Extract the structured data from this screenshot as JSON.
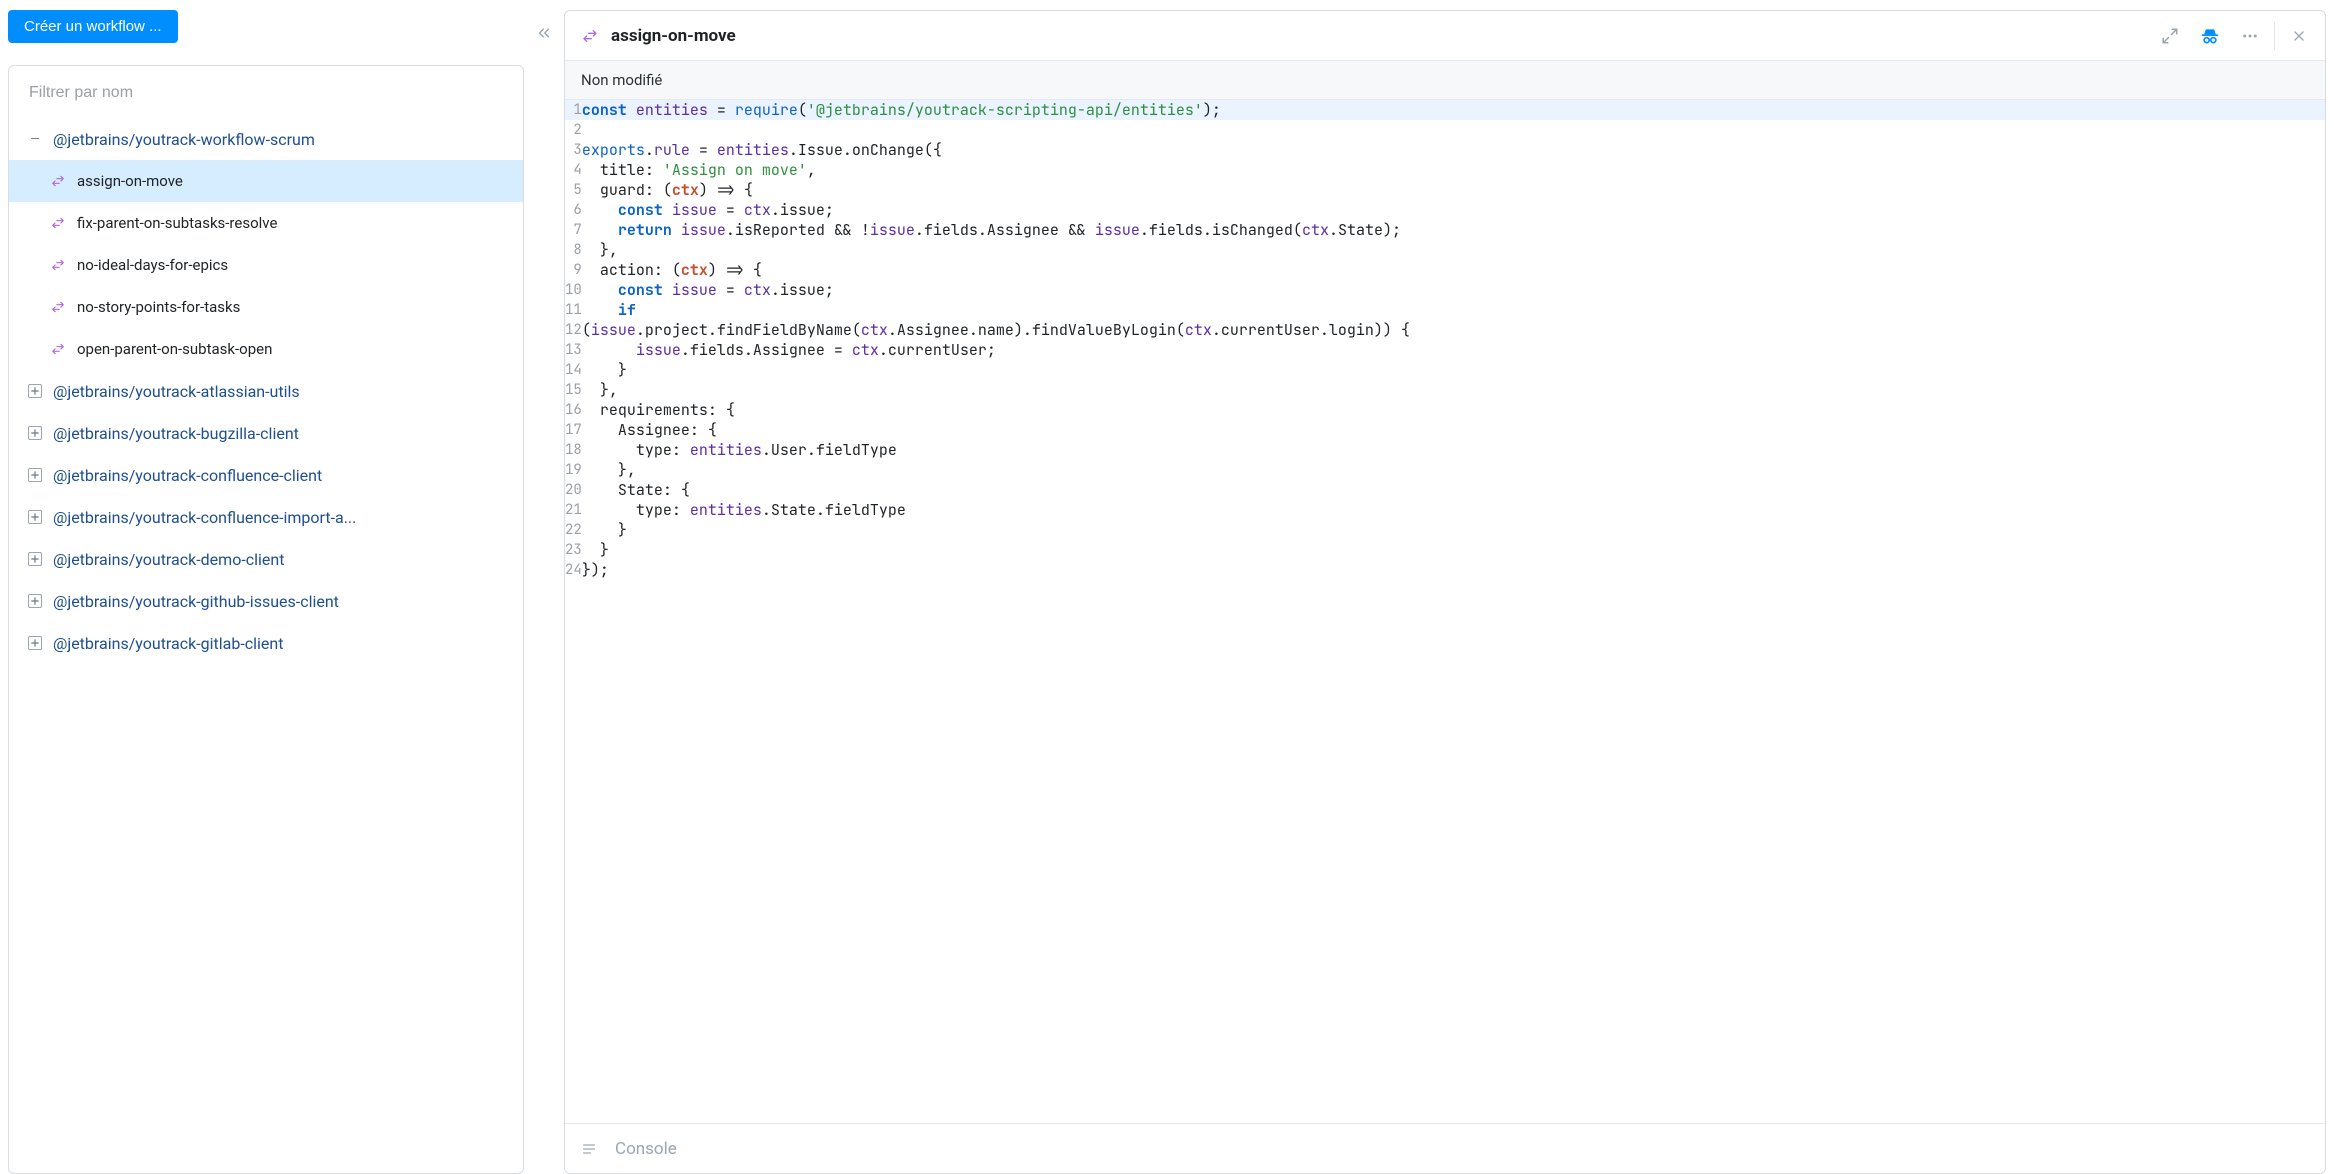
{
  "buttons": {
    "create_workflow": "Créer un workflow ..."
  },
  "filter": {
    "placeholder": "Filtrer par nom"
  },
  "tree": {
    "packages": [
      {
        "name": "@jetbrains/youtrack-workflow-scrum",
        "expanded": true,
        "rules": [
          {
            "name": "assign-on-move",
            "selected": true
          },
          {
            "name": "fix-parent-on-subtasks-resolve"
          },
          {
            "name": "no-ideal-days-for-epics"
          },
          {
            "name": "no-story-points-for-tasks"
          },
          {
            "name": "open-parent-on-subtask-open"
          }
        ]
      },
      {
        "name": "@jetbrains/youtrack-atlassian-utils",
        "expanded": false
      },
      {
        "name": "@jetbrains/youtrack-bugzilla-client",
        "expanded": false
      },
      {
        "name": "@jetbrains/youtrack-confluence-client",
        "expanded": false
      },
      {
        "name": "@jetbrains/youtrack-confluence-import-a...",
        "expanded": false
      },
      {
        "name": "@jetbrains/youtrack-demo-client",
        "expanded": false
      },
      {
        "name": "@jetbrains/youtrack-github-issues-client",
        "expanded": false
      },
      {
        "name": "@jetbrains/youtrack-gitlab-client",
        "expanded": false
      }
    ]
  },
  "editor": {
    "title": "assign-on-move",
    "status": "Non modifié",
    "console_label": "Console",
    "code_tokens": [
      [
        {
          "t": "const ",
          "c": "kw"
        },
        {
          "t": "entities",
          "c": "ident"
        },
        {
          "t": " = "
        },
        {
          "t": "require",
          "c": "kw2"
        },
        {
          "t": "("
        },
        {
          "t": "'@jetbrains/youtrack-scripting-api/entities'",
          "c": "str"
        },
        {
          "t": ");"
        }
      ],
      [],
      [
        {
          "t": "exports",
          "c": "kw2"
        },
        {
          "t": "."
        },
        {
          "t": "rule",
          "c": "ident"
        },
        {
          "t": " = "
        },
        {
          "t": "entities",
          "c": "ident"
        },
        {
          "t": ".Issue.onChange({"
        }
      ],
      [
        {
          "t": "  title: "
        },
        {
          "t": "'Assign on move'",
          "c": "str"
        },
        {
          "t": ","
        }
      ],
      [
        {
          "t": "  guard: ("
        },
        {
          "t": "ctx",
          "c": "param"
        },
        {
          "t": ") => {"
        }
      ],
      [
        {
          "t": "    "
        },
        {
          "t": "const ",
          "c": "kw"
        },
        {
          "t": "issue",
          "c": "ident"
        },
        {
          "t": " = "
        },
        {
          "t": "ctx",
          "c": "ident"
        },
        {
          "t": ".issue;"
        }
      ],
      [
        {
          "t": "    "
        },
        {
          "t": "return ",
          "c": "kw"
        },
        {
          "t": "issue",
          "c": "ident"
        },
        {
          "t": ".isReported && !"
        },
        {
          "t": "issue",
          "c": "ident"
        },
        {
          "t": ".fields.Assignee && "
        },
        {
          "t": "issue",
          "c": "ident"
        },
        {
          "t": ".fields.isChanged("
        },
        {
          "t": "ctx",
          "c": "ident"
        },
        {
          "t": ".State);"
        }
      ],
      [
        {
          "t": "  },"
        }
      ],
      [
        {
          "t": "  action: ("
        },
        {
          "t": "ctx",
          "c": "param"
        },
        {
          "t": ") => {"
        }
      ],
      [
        {
          "t": "    "
        },
        {
          "t": "const ",
          "c": "kw"
        },
        {
          "t": "issue",
          "c": "ident"
        },
        {
          "t": " = "
        },
        {
          "t": "ctx",
          "c": "ident"
        },
        {
          "t": ".issue;"
        }
      ],
      [
        {
          "t": "    "
        },
        {
          "t": "if",
          "c": "kw"
        }
      ],
      [
        {
          "t": "("
        },
        {
          "t": "issue",
          "c": "ident"
        },
        {
          "t": ".project.findFieldByName("
        },
        {
          "t": "ctx",
          "c": "ident"
        },
        {
          "t": ".Assignee.name).findValueByLogin("
        },
        {
          "t": "ctx",
          "c": "ident"
        },
        {
          "t": ".currentUser.login)) {"
        }
      ],
      [
        {
          "t": "      "
        },
        {
          "t": "issue",
          "c": "ident"
        },
        {
          "t": ".fields.Assignee = "
        },
        {
          "t": "ctx",
          "c": "ident"
        },
        {
          "t": ".currentUser;"
        }
      ],
      [
        {
          "t": "    }"
        }
      ],
      [
        {
          "t": "  },"
        }
      ],
      [
        {
          "t": "  requirements: {"
        }
      ],
      [
        {
          "t": "    Assignee: {"
        }
      ],
      [
        {
          "t": "      type: "
        },
        {
          "t": "entities",
          "c": "ident"
        },
        {
          "t": ".User.fieldType"
        }
      ],
      [
        {
          "t": "    },"
        }
      ],
      [
        {
          "t": "    State: {"
        }
      ],
      [
        {
          "t": "      type: "
        },
        {
          "t": "entities",
          "c": "ident"
        },
        {
          "t": ".State.fieldType"
        }
      ],
      [
        {
          "t": "    }"
        }
      ],
      [
        {
          "t": "  }"
        }
      ],
      [
        {
          "t": "});"
        }
      ]
    ],
    "highlight_line": 1
  }
}
